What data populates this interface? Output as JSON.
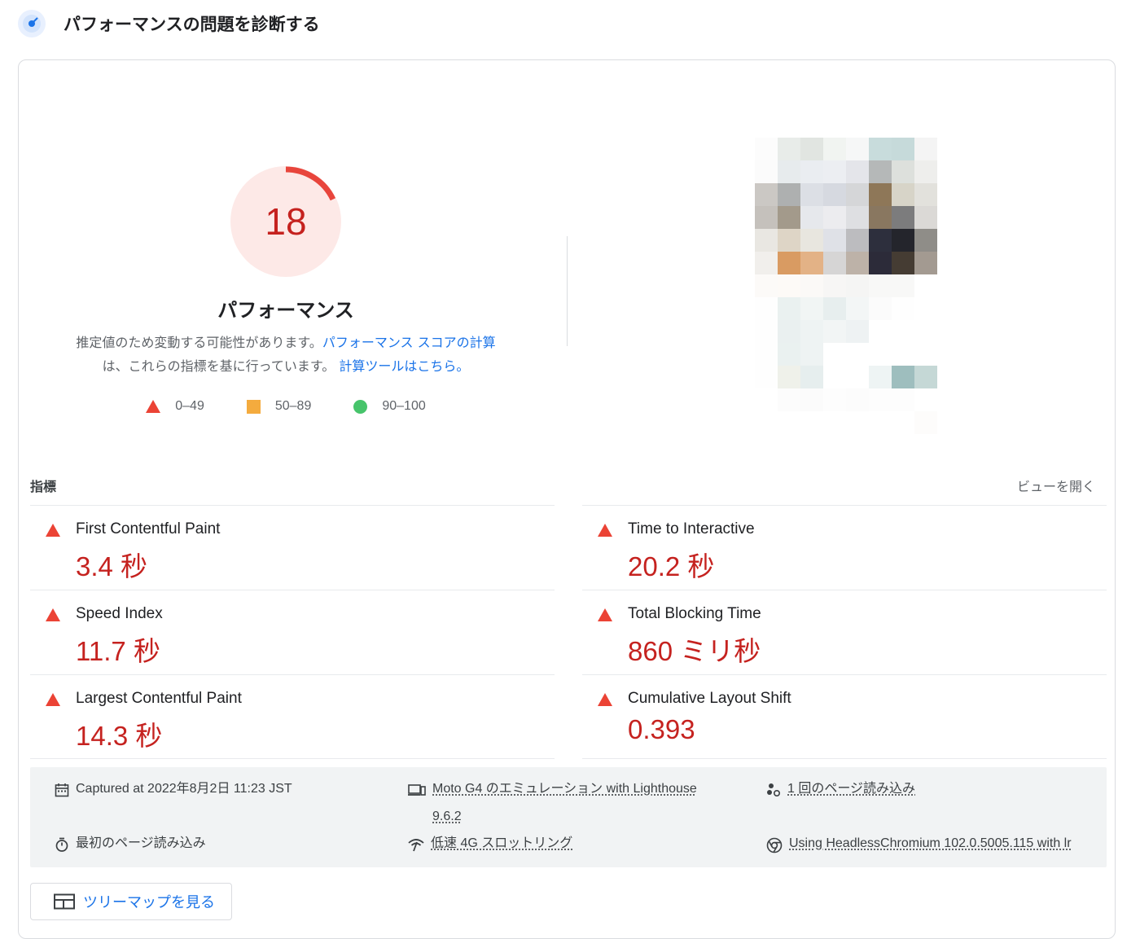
{
  "header": {
    "title": "パフォーマンスの問題を診断する"
  },
  "gauge": {
    "score": "18",
    "title": "パフォーマンス",
    "fraction": 0.18,
    "color": "#e8453c"
  },
  "description": {
    "text1": "推定値のため変動する可能性があります。",
    "link1": "パフォーマンス スコアの計算",
    "text2": "は、これらの指標を基に行っています。",
    "link2": "計算ツールはこちら。"
  },
  "legend": [
    {
      "icon": "triangle-red-icon",
      "label": "0–49"
    },
    {
      "icon": "square-orange-icon",
      "label": "50–89"
    },
    {
      "icon": "circle-green-icon",
      "label": "90–100"
    }
  ],
  "metrics": {
    "label": "指標",
    "view_toggle": "ビューを開く",
    "items": [
      {
        "name": "First Contentful Paint",
        "value": "3.4 秒"
      },
      {
        "name": "Time to Interactive",
        "value": "20.2 秒"
      },
      {
        "name": "Speed Index",
        "value": "11.7 秒"
      },
      {
        "name": "Total Blocking Time",
        "value": "860 ミリ秒"
      },
      {
        "name": "Largest Contentful Paint",
        "value": "14.3 秒"
      },
      {
        "name": "Cumulative Layout Shift",
        "value": "0.393"
      }
    ]
  },
  "info": {
    "captured": "Captured at 2022年8月2日 11:23 JST",
    "device_line1": "Moto G4 のエミュレーション with Lighthouse",
    "device_line2": "9.6.2",
    "page_loads": "1 回のページ読み込み",
    "initial_load": "最初のページ読み込み",
    "throttling": "低速 4G スロットリング",
    "browser": "Using HeadlessChromium 102.0.5005.115 with lr"
  },
  "treemap_button": "ツリーマップを見る"
}
